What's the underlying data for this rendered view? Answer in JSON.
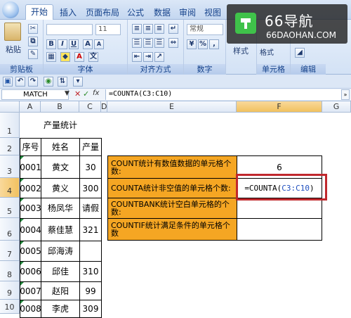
{
  "ribbon": {
    "tabs": [
      "开始",
      "插入",
      "页面布局",
      "公式",
      "数据",
      "审阅",
      "视图"
    ],
    "paste_label": "粘贴",
    "groups": [
      "剪贴板",
      "字体",
      "对齐方式",
      "数字",
      "单元格",
      "编辑"
    ],
    "font_size": "11",
    "number_format": "常规",
    "style_label": "样式",
    "format_label": "格式"
  },
  "watermark": {
    "brand": "66导航",
    "site": "66DAOHAN.COM"
  },
  "formula_bar": {
    "name_box": "MATCH",
    "fx": "fx",
    "formula": "=COUNTA(C3:C10)"
  },
  "columns": [
    "A",
    "B",
    "C",
    "D",
    "E",
    "F",
    "G"
  ],
  "rows": [
    "1",
    "2",
    "3",
    "4",
    "5",
    "6",
    "7",
    "8",
    "9",
    "10"
  ],
  "sheet": {
    "title": "产量统计",
    "headers": [
      "序号",
      "姓名",
      "产量"
    ],
    "data": [
      [
        "0001",
        "黄文",
        "30"
      ],
      [
        "0002",
        "黄义",
        "300"
      ],
      [
        "0003",
        "杨凤华",
        "请假"
      ],
      [
        "0004",
        "蔡佳慧",
        "321"
      ],
      [
        "0005",
        "邱海涛",
        ""
      ],
      [
        "0006",
        "邱佳",
        "310"
      ],
      [
        "0007",
        "赵阳",
        "99"
      ],
      [
        "0008",
        "李虎",
        "309"
      ]
    ],
    "stats": [
      {
        "label": "COUNT统计有数值数据的单元格个数:",
        "value": "6"
      },
      {
        "label": "COUNTA统计非空值的单元格个数:",
        "value": "=COUNTA(C3:C10)"
      },
      {
        "label": "COUNTBANK统计空白单元格的个数:",
        "value": ""
      },
      {
        "label": "COUNTIF统计满足条件的单元格个数",
        "value": ""
      }
    ],
    "formula_prefix": "=COUNTA(",
    "formula_ref": "C3:C10",
    "formula_suffix": ")"
  },
  "colors": {
    "highlight": "#f5a623",
    "red_box": "#c0282d",
    "ref_blue": "#1f4fbf"
  }
}
